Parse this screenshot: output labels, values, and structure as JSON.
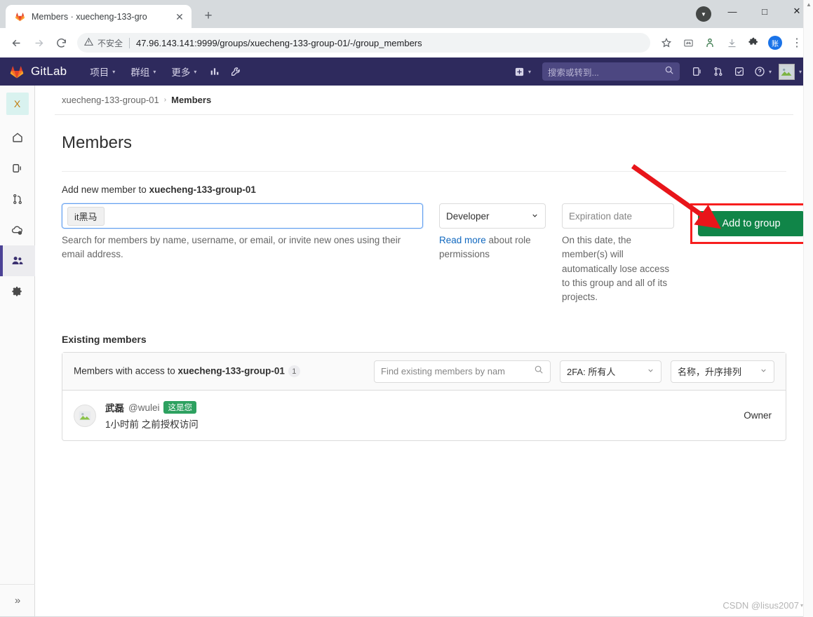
{
  "browser": {
    "tab": {
      "title": "Members · xuecheng-133-gro",
      "favicon_icon": "gitlab-fox-icon",
      "close_icon": "close-icon"
    },
    "new_tab_label": "+",
    "window_controls": {
      "minimize": "—",
      "maximize": "□",
      "close": "✕",
      "profile_icon": "profile-avatar-icon"
    },
    "toolbar": {
      "back_icon": "back-arrow-icon",
      "forward_icon": "forward-arrow-icon",
      "reload_icon": "reload-icon",
      "security_warning_icon": "warning-triangle-icon",
      "security_label": "不安全",
      "url": "47.96.143.141:9999/groups/xuecheng-133-group-01/-/group_members",
      "bookmark_icon": "star-icon",
      "translate_icon": "translate-icon",
      "extension_icon": "extension-person-icon",
      "download_icon": "download-icon",
      "puzzle_icon": "puzzle-piece-icon",
      "profile_badge": "账",
      "menu_icon": "kebab-menu-icon"
    }
  },
  "gitlab_nav": {
    "brand": "GitLab",
    "logo_icon": "gitlab-fox-icon",
    "items": [
      {
        "label": "项目",
        "caret": "▾"
      },
      {
        "label": "群组",
        "caret": "▾"
      },
      {
        "label": "更多",
        "caret": "▾"
      }
    ],
    "icons": [
      {
        "name": "analytics-chart-icon",
        "glyph": "◨"
      },
      {
        "name": "wrench-icon",
        "glyph": "🔧"
      }
    ],
    "create_new": {
      "icon": "plus-square-icon",
      "caret": "▾"
    },
    "search": {
      "placeholder": "搜索或转到...",
      "icon": "search-icon"
    },
    "right_icons": [
      {
        "name": "issues-icon",
        "glyph": "▯)"
      },
      {
        "name": "merge-requests-icon",
        "glyph": "⑂"
      },
      {
        "name": "todos-icon",
        "glyph": "☑"
      },
      {
        "name": "help-icon",
        "glyph": "?"
      }
    ],
    "avatar": {
      "name": "user-avatar",
      "caret": "▾"
    }
  },
  "sidebar": {
    "group_avatar_letter": "X",
    "items": [
      {
        "name": "sidebar-item-overview",
        "icon": "home-icon",
        "active": false
      },
      {
        "name": "sidebar-item-issues",
        "icon": "issues-icon",
        "active": false
      },
      {
        "name": "sidebar-item-merge-requests",
        "icon": "merge-request-icon",
        "active": false
      },
      {
        "name": "sidebar-item-kubernetes",
        "icon": "kubernetes-cloud-icon",
        "active": false
      },
      {
        "name": "sidebar-item-members",
        "icon": "members-people-icon",
        "active": true
      },
      {
        "name": "sidebar-item-settings",
        "icon": "gear-icon",
        "active": false
      }
    ],
    "collapse_icon": "double-chevron-right-icon"
  },
  "breadcrumb": {
    "group": "xuecheng-133-group-01",
    "separator": "›",
    "current": "Members"
  },
  "page": {
    "title": "Members"
  },
  "add_member": {
    "label_prefix": "Add new member to ",
    "group_name": "xuecheng-133-group-01",
    "search": {
      "token_value": "it黑马",
      "helper_text": "Search for members by name, username, or email, or invite new ones using their email address."
    },
    "role": {
      "selected": "Developer",
      "caret": "⌄",
      "read_more_link": "Read more",
      "helper_suffix": " about role permissions"
    },
    "expiration": {
      "placeholder": "Expiration date",
      "helper_text": "On this date, the member(s) will automatically lose access to this group and all of its projects."
    },
    "submit_button": "Add to group",
    "annotation": {
      "box_color": "#f71e1e",
      "arrow_color": "#e8151a"
    }
  },
  "existing_members": {
    "section_title": "Existing members",
    "panel_header": {
      "prefix": "Members with access to ",
      "group_name": "xuecheng-133-group-01",
      "count": "1"
    },
    "find_input": {
      "placeholder": "Find existing members by nam",
      "icon": "search-icon"
    },
    "twofa_filter": {
      "label": "2FA: 所有人",
      "caret": "⌄"
    },
    "sort_filter": {
      "label": "名称，升序排列",
      "caret": "⌄"
    },
    "rows": [
      {
        "avatar_icon": "user-avatar-placeholder-icon",
        "name": "武磊",
        "handle": "@wulei",
        "badge": "这是您",
        "meta": "1小时前 之前授权访问",
        "role": "Owner"
      }
    ]
  },
  "watermark": {
    "text": "CSDN @lisus2007"
  },
  "colors": {
    "gitlab_nav": "#2e2a5d",
    "primary_green": "#108548",
    "badge_green": "#2da160",
    "link_blue": "#1068bf",
    "annotation_red": "#f71e1e",
    "sidebar_active": "#4b4295"
  }
}
